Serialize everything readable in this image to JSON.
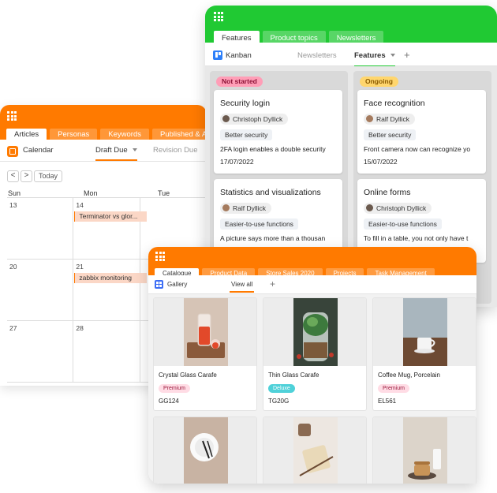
{
  "calendar_window": {
    "tabs": [
      "Articles",
      "Personas",
      "Keywords",
      "Published & A"
    ],
    "view_name": "Calendar",
    "view_tabs": [
      "Draft Due",
      "Revision Due"
    ],
    "today_label": "Today",
    "nav_prev": "<",
    "nav_next": ">",
    "weekdays": [
      "Sun",
      "Mon",
      "Tue"
    ],
    "weeks": [
      {
        "days": [
          "13",
          "14",
          ""
        ],
        "event": "Terminator vs glor..."
      },
      {
        "days": [
          "20",
          "21",
          ""
        ],
        "event": "zabbix monitoring"
      },
      {
        "days": [
          "27",
          "28",
          ""
        ],
        "event": ""
      }
    ],
    "colors": {
      "header": "#ff7a00",
      "event_bg": "#fbd7c6"
    }
  },
  "kanban_window": {
    "tabs": [
      "Features",
      "Product topics",
      "Newsletters"
    ],
    "view_name": "Kanban",
    "view_tabs": [
      "Newsletters",
      "Features"
    ],
    "add_view": "+",
    "columns": [
      {
        "status": "Not started",
        "status_bg": "#ff9eb7",
        "status_fg": "#8c1236",
        "cards": [
          {
            "title": "Security login",
            "owner": "Christoph Dyllick",
            "tag": "Better security",
            "desc": "2FA login enables a double security",
            "date": "17/07/2022"
          },
          {
            "title": "Statistics and visualizations",
            "owner": "Ralf Dyllick",
            "tag": "Easier-to-use functions",
            "desc": "A picture says more than a thousan",
            "date": ""
          }
        ]
      },
      {
        "status": "Ongoing",
        "status_bg": "#ffd66e",
        "status_fg": "#8a5a00",
        "cards": [
          {
            "title": "Face recognition",
            "owner": "Ralf Dyllick",
            "tag": "Better security",
            "desc": "Front camera now can recognize yo",
            "date": "15/07/2022"
          },
          {
            "title": "Online forms",
            "owner": "Christoph Dyllick",
            "tag": "Easier-to-use functions",
            "desc": "To fill in a table, you not only have t",
            "date": ""
          }
        ]
      }
    ],
    "colors": {
      "header": "#20c933",
      "view_icon": "#2d7ff9"
    }
  },
  "gallery_window": {
    "tabs": [
      "Catalogue",
      "Product Data",
      "Store Sales 2020",
      "Projects",
      "Task Management"
    ],
    "view_name": "Gallery",
    "view_tab": "View all",
    "add_view": "+",
    "items": [
      {
        "name": "Crystal Glass Carafe",
        "badge": "Premium",
        "sku": "GG124",
        "photo": "carafe"
      },
      {
        "name": "Thin Glass Carafe",
        "badge": "Deluxe",
        "sku": "TG20G",
        "photo": "plant-jar"
      },
      {
        "name": "Coffee Mug, Porcelain",
        "badge": "Premium",
        "sku": "EL561",
        "photo": "mug"
      },
      {
        "name": "",
        "badge": "",
        "sku": "",
        "photo": "plate"
      },
      {
        "name": "",
        "badge": "",
        "sku": "",
        "photo": "cup-and-board"
      },
      {
        "name": "",
        "badge": "",
        "sku": "",
        "photo": "pancakes"
      }
    ],
    "badge_styles": {
      "Premium": {
        "bg": "#ffdce5",
        "fg": "#9c1b3e"
      },
      "Deluxe": {
        "bg": "#4fd1d9",
        "fg": "#ffffff"
      }
    },
    "colors": {
      "header": "#ff7a00",
      "view_icon": "#3d6ef5"
    }
  }
}
